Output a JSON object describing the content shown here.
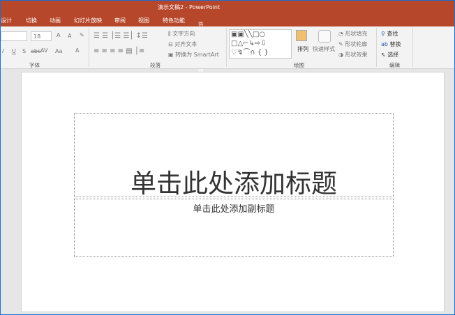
{
  "window": {
    "title": "演示文稿2 - PowerPoint"
  },
  "tabs": [
    "设计",
    "切换",
    "动画",
    "幻灯片放映",
    "审阅",
    "视图",
    "特色功能"
  ],
  "tell_me": "告诉我您想要做什么...",
  "ribbon": {
    "font": {
      "size": "18",
      "label": "字体",
      "grow": "A",
      "shrink": "A",
      "case": "Aa",
      "color": "A",
      "bold": "I",
      "underline": "U",
      "shadow": "S",
      "strike": "abc",
      "spacing": "AV"
    },
    "paragraph": {
      "label": "段落",
      "text_direction": "文字方向",
      "align_text": "对齐文本",
      "smartart": "转换为 SmartArt"
    },
    "drawing": {
      "label": "绘图",
      "arrange": "排列",
      "quick_styles": "快速样式",
      "fill": "形状填充",
      "outline": "形状轮廓",
      "effects": "形状效果"
    },
    "editing": {
      "label": "编辑",
      "find": "查找",
      "replace": "替换",
      "select": "选择"
    }
  },
  "slide": {
    "title_placeholder": "单击此处添加标题",
    "subtitle_placeholder": "单击此处添加副标题"
  },
  "colors": {
    "accent": "#b7472a"
  }
}
